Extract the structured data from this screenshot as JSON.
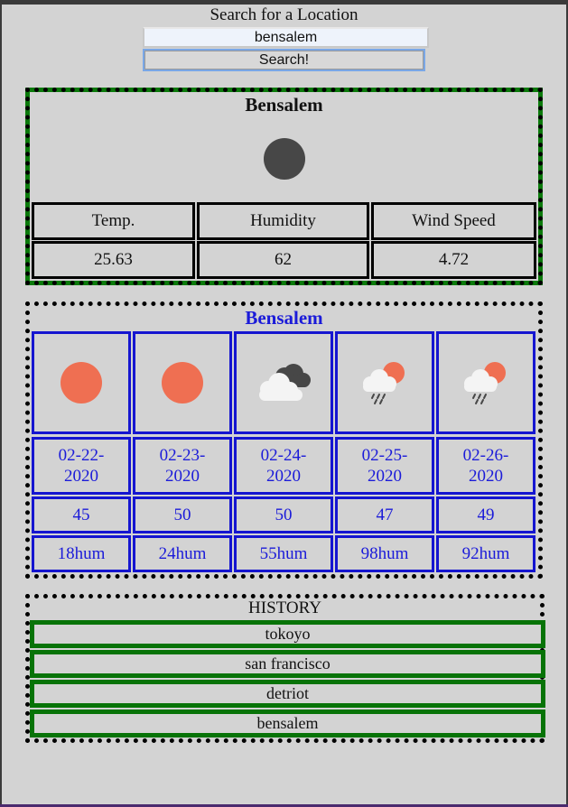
{
  "search": {
    "label": "Search for a Location",
    "value": "bensalem",
    "button_label": "Search!"
  },
  "current": {
    "city": "Bensalem",
    "icon": "moon-icon",
    "headers": [
      "Temp.",
      "Humidity",
      "Wind Speed"
    ],
    "values": [
      "25.63",
      "62",
      "4.72"
    ]
  },
  "forecast": {
    "city": "Bensalem",
    "days": [
      {
        "icon": "sun-icon",
        "date": "02-22-\n2020",
        "temp": "45",
        "humidity": "18hum"
      },
      {
        "icon": "sun-icon",
        "date": "02-23-\n2020",
        "temp": "50",
        "humidity": "24hum"
      },
      {
        "icon": "cloudy-icon",
        "date": "02-24-\n2020",
        "temp": "50",
        "humidity": "55hum"
      },
      {
        "icon": "rain-sun-icon",
        "date": "02-25-\n2020",
        "temp": "47",
        "humidity": "98hum"
      },
      {
        "icon": "rain-sun-icon",
        "date": "02-26-\n2020",
        "temp": "49",
        "humidity": "92hum"
      }
    ]
  },
  "history": {
    "title": "HISTORY",
    "items": [
      "tokoyo",
      "san francisco",
      "detriot",
      "bensalem"
    ]
  },
  "colors": {
    "background": "#d3d3d3",
    "forecast_text": "#1b1bd9",
    "history_border": "#077307",
    "sun": "#ef6f52",
    "moon": "#474747"
  }
}
